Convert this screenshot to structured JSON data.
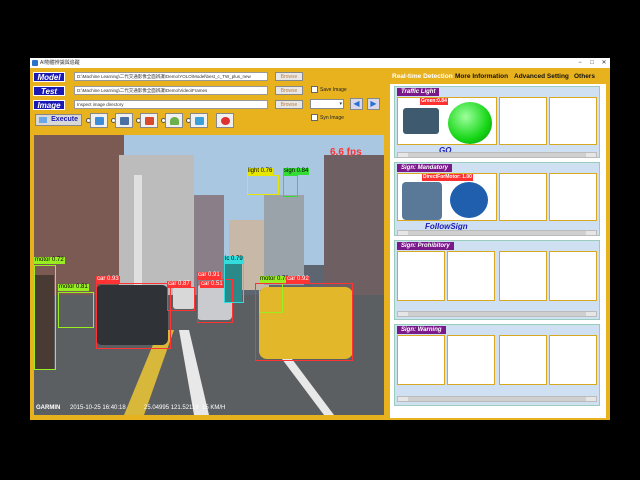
{
  "window": {
    "title": "AI物體辨識與追蹤",
    "controls": {
      "minimize": "−",
      "maximize": "□",
      "close": "✕"
    }
  },
  "rows": {
    "model": {
      "label": "Model",
      "path": "D:\\Machine Learning\\二代交通影像全面辨識\\Demo\\YOLO\\Model\\best_c_TW_plus_new",
      "browse": "Browse"
    },
    "test": {
      "label": "Test",
      "path": "D:\\Machine Learning\\二代交通影像全面辨識\\Demo\\Video\\Frames",
      "browse": "Browse"
    },
    "image": {
      "label": "Image",
      "path": "Inspect image directory",
      "browse": "Browse"
    }
  },
  "options": {
    "save_image": "Save Image",
    "syn_image": "Syn Image"
  },
  "toolbar": {
    "execute": "Execute",
    "prev_icon": "arrow-left-icon",
    "next_icon": "arrow-right-icon"
  },
  "video": {
    "overlay_date": "2015-10-25 16:40:18",
    "overlay_gps": "25.04995 121.52119",
    "overlay_speed": "15 KM/H",
    "brand": "GARMIN",
    "corner_label": "6.6 fps",
    "detections": [
      {
        "label": "light 0.76",
        "color": "#e6e600"
      },
      {
        "label": "sign 0.84",
        "color": "#33dd33"
      },
      {
        "label": "motor 0.72",
        "color": "#99ee22"
      },
      {
        "label": "motor 0.81",
        "color": "#99ee22"
      },
      {
        "label": "car 0.93",
        "color": "#ff3333"
      },
      {
        "label": "car 0.91",
        "color": "#ff3333"
      },
      {
        "label": "car 0.87",
        "color": "#ff3333"
      },
      {
        "label": "car 0.51",
        "color": "#ff3333"
      },
      {
        "label": "lc 0.79",
        "color": "#33dddd"
      },
      {
        "label": "motor 0.78",
        "color": "#99ee22"
      },
      {
        "label": "car 0.92",
        "color": "#ff3333"
      }
    ]
  },
  "right_panel": {
    "tabs": [
      "Real-time Detection",
      "More Information",
      "Advanced Setting",
      "Others"
    ],
    "sections": [
      {
        "title": "Traffic Light",
        "caption": "GO",
        "detection": "Green:0.84"
      },
      {
        "title": "Sign: Mandatory",
        "caption": "FollowSign",
        "detection": "DirectForMotor: 1.00"
      },
      {
        "title": "Sign: Prohibitory",
        "caption": "",
        "detection": ""
      },
      {
        "title": "Sign: Warning",
        "caption": "",
        "detection": ""
      }
    ]
  },
  "colors": {
    "frame": "#e8b21e",
    "label_bg": "#1a1ab3",
    "section_header": "#7a1a8a"
  }
}
